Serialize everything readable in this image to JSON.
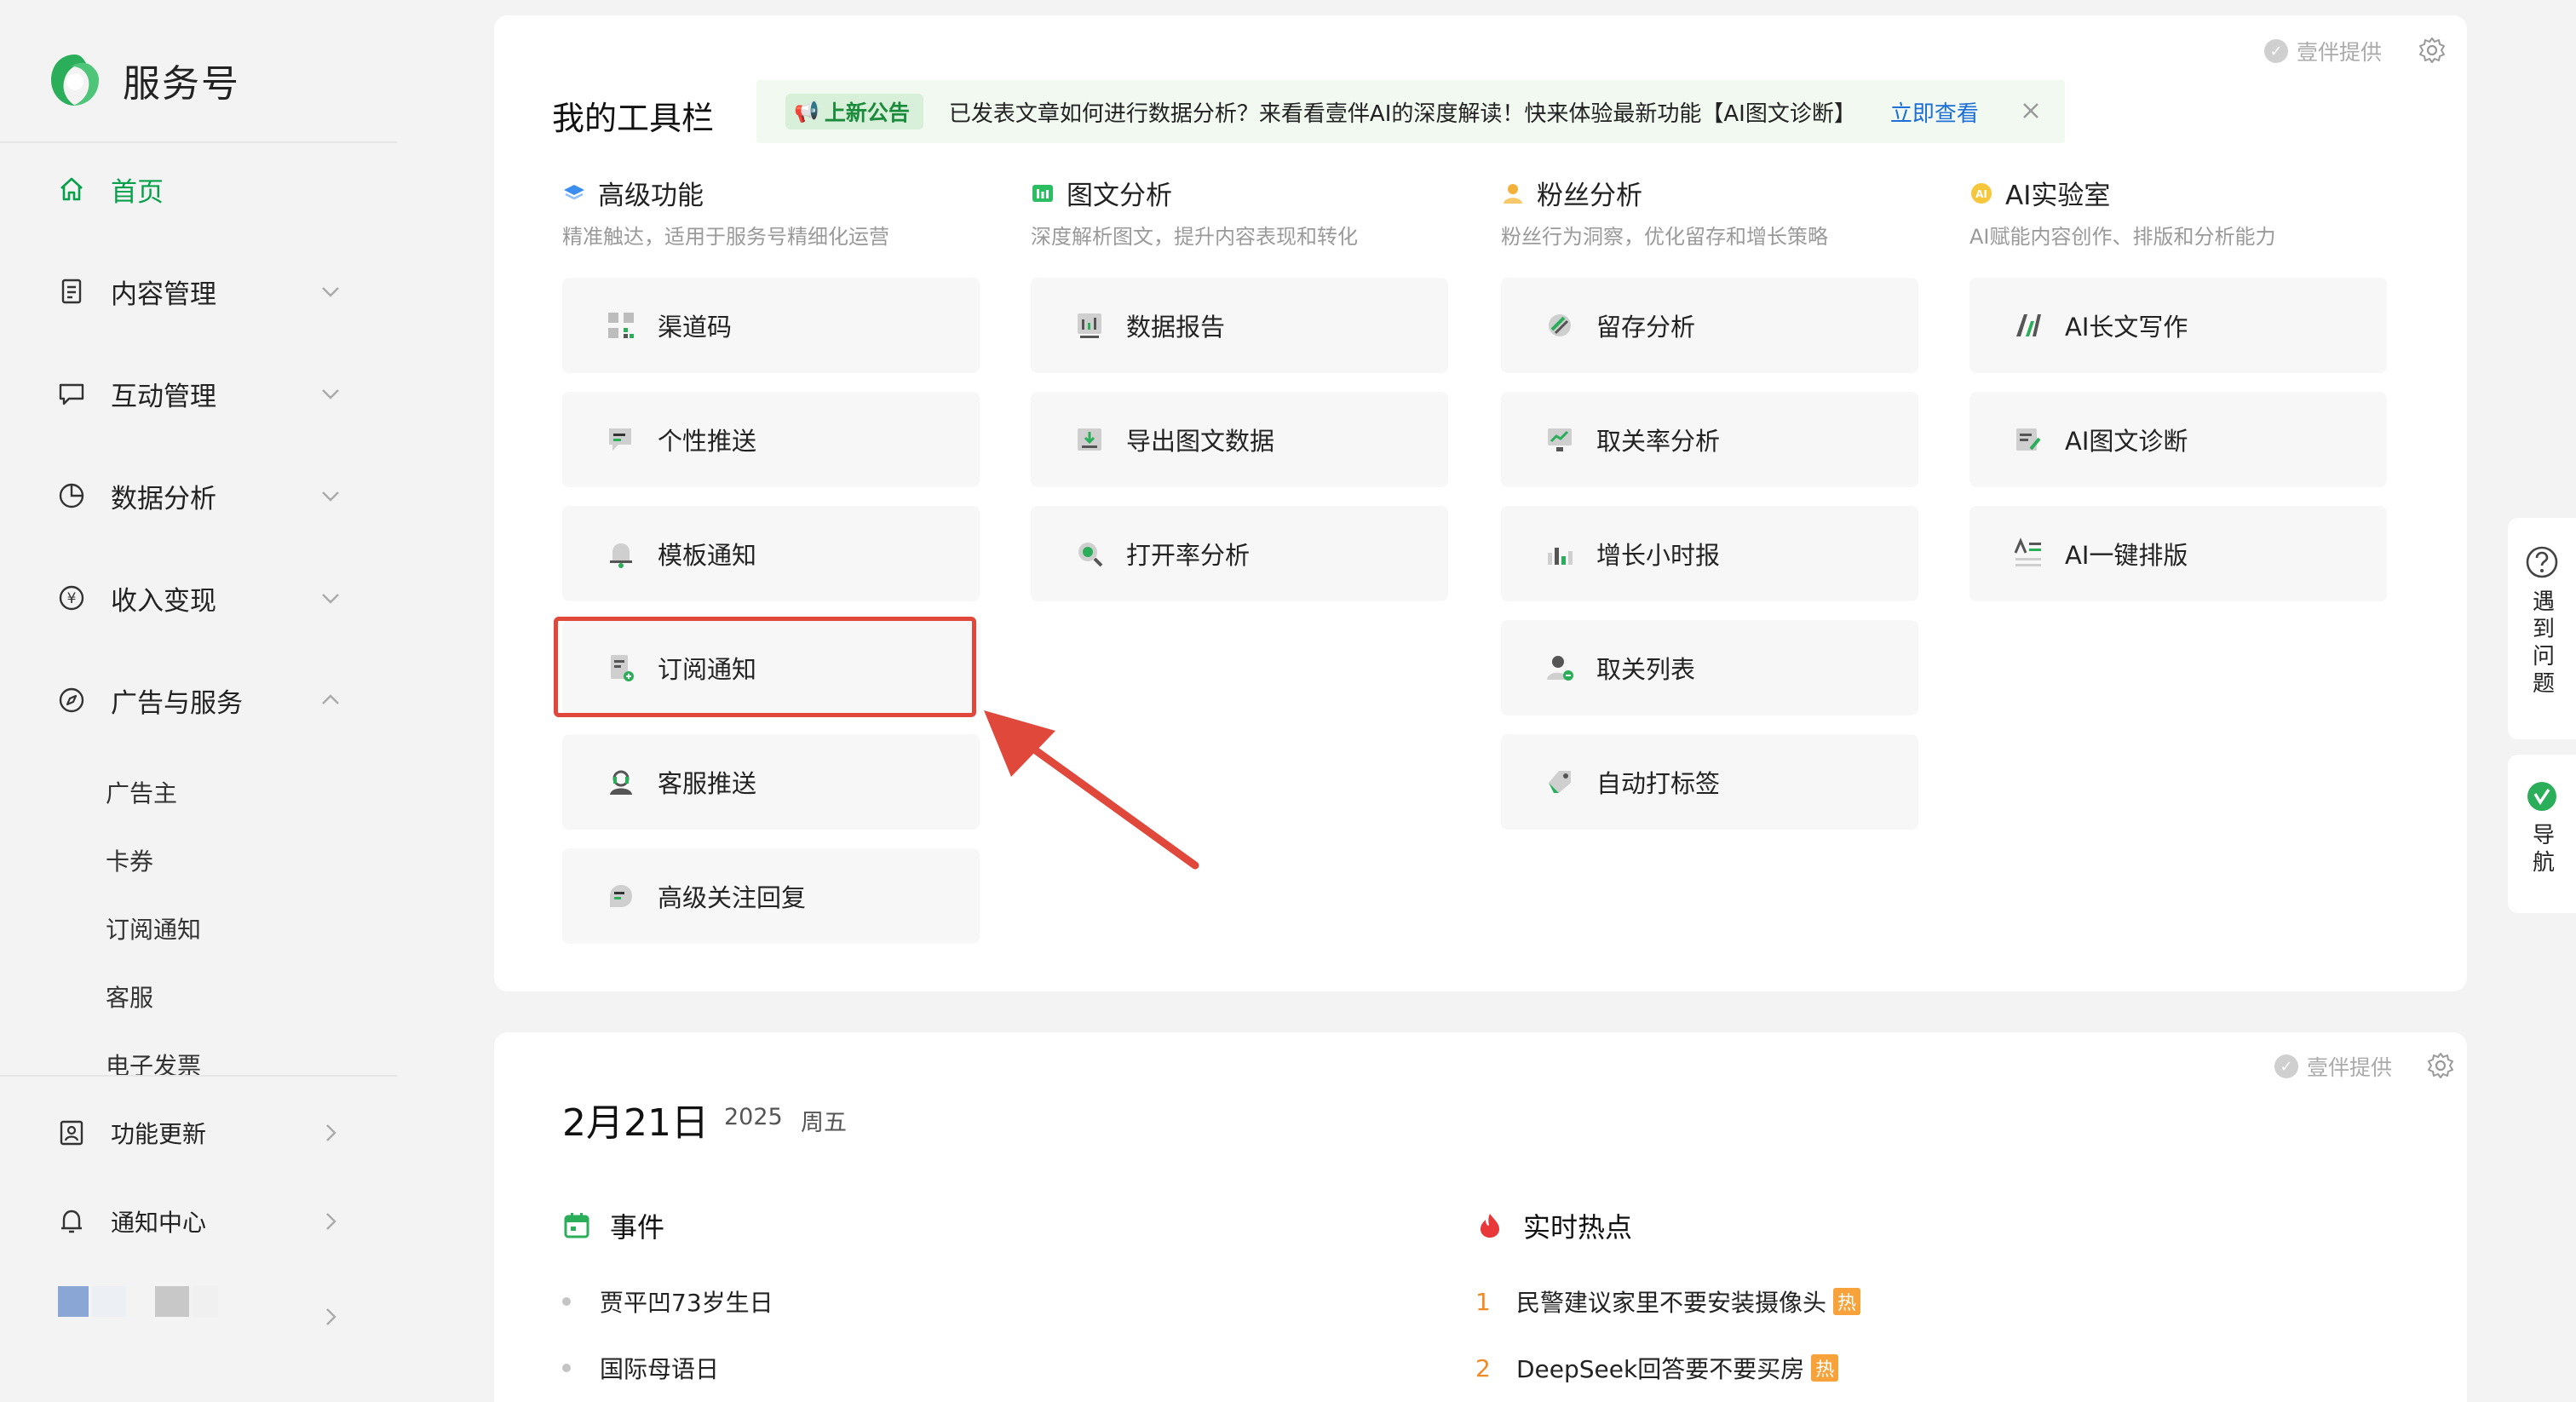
{
  "brand": {
    "name": "服务号",
    "color": "#07a04a"
  },
  "sidebar": {
    "items": [
      {
        "label": "首页",
        "icon": "home-icon",
        "active": true
      },
      {
        "label": "内容管理",
        "icon": "document-icon"
      },
      {
        "label": "互动管理",
        "icon": "chat-icon"
      },
      {
        "label": "数据分析",
        "icon": "pie-chart-icon"
      },
      {
        "label": "收入变现",
        "icon": "yuan-icon"
      },
      {
        "label": "广告与服务",
        "icon": "compass-icon",
        "expanded": true
      }
    ],
    "sub_items": [
      "广告主",
      "卡券",
      "订阅通知",
      "客服",
      "电子发票"
    ],
    "bottom_items": [
      {
        "label": "功能更新",
        "icon": "update-icon"
      },
      {
        "label": "通知中心",
        "icon": "bell-icon"
      }
    ]
  },
  "toolbar": {
    "provider": "壹伴提供",
    "title": "我的工具栏",
    "notice": {
      "tag": "上新公告",
      "text": "已发表文章如何进行数据分析？来看看壹伴AI的深度解读！快来体验最新功能【AI图文诊断】",
      "link": "立即查看"
    },
    "columns": [
      {
        "title": "高级功能",
        "desc": "精准触达，适用于服务号精细化运营",
        "icon": "layers-icon",
        "tools": [
          "渠道码",
          "个性推送",
          "模板通知",
          "订阅通知",
          "客服推送",
          "高级关注回复"
        ]
      },
      {
        "title": "图文分析",
        "desc": "深度解析图文，提升内容表现和转化",
        "icon": "bar-chart-icon",
        "tools": [
          "数据报告",
          "导出图文数据",
          "打开率分析"
        ]
      },
      {
        "title": "粉丝分析",
        "desc": "粉丝行为洞察，优化留存和增长策略",
        "icon": "user-icon",
        "tools": [
          "留存分析",
          "取关率分析",
          "增长小时报",
          "取关列表",
          "自动打标签"
        ]
      },
      {
        "title": "AI实验室",
        "desc": "AI赋能内容创作、排版和分析能力",
        "icon": "ai-icon",
        "tools": [
          "AI长文写作",
          "AI图文诊断",
          "AI一键排版"
        ]
      }
    ],
    "highlighted_tool": "订阅通知"
  },
  "float": {
    "help_label": "遇到问题",
    "nav_label": "导航"
  },
  "calendar": {
    "provider": "壹伴提供",
    "date": "2月21日",
    "year": "2025",
    "weekday": "周五",
    "events_title": "事件",
    "events": [
      "贾平凹73岁生日",
      "国际母语日"
    ],
    "hot_title": "实时热点",
    "hot": [
      {
        "rank": "1",
        "text": "民警建议家里不要安装摄像头",
        "badge": "热"
      },
      {
        "rank": "2",
        "text": "DeepSeek回答要不要买房",
        "badge": "热"
      }
    ]
  }
}
